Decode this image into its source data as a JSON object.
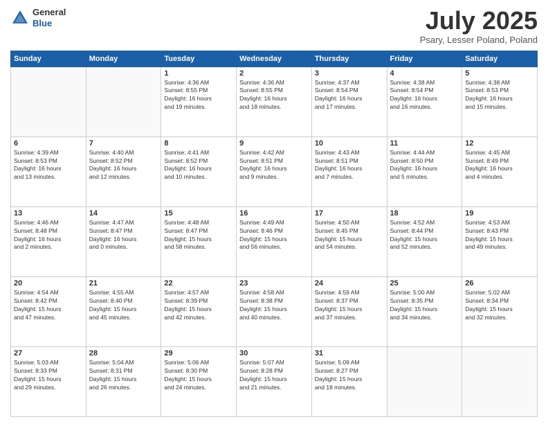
{
  "header": {
    "logo_general": "General",
    "logo_blue": "Blue",
    "title": "July 2025",
    "subtitle": "Psary, Lesser Poland, Poland"
  },
  "days_of_week": [
    "Sunday",
    "Monday",
    "Tuesday",
    "Wednesday",
    "Thursday",
    "Friday",
    "Saturday"
  ],
  "weeks": [
    [
      {
        "day": "",
        "info": ""
      },
      {
        "day": "",
        "info": ""
      },
      {
        "day": "1",
        "info": "Sunrise: 4:36 AM\nSunset: 8:55 PM\nDaylight: 16 hours\nand 19 minutes."
      },
      {
        "day": "2",
        "info": "Sunrise: 4:36 AM\nSunset: 8:55 PM\nDaylight: 16 hours\nand 18 minutes."
      },
      {
        "day": "3",
        "info": "Sunrise: 4:37 AM\nSunset: 8:54 PM\nDaylight: 16 hours\nand 17 minutes."
      },
      {
        "day": "4",
        "info": "Sunrise: 4:38 AM\nSunset: 8:54 PM\nDaylight: 16 hours\nand 16 minutes."
      },
      {
        "day": "5",
        "info": "Sunrise: 4:38 AM\nSunset: 8:53 PM\nDaylight: 16 hours\nand 15 minutes."
      }
    ],
    [
      {
        "day": "6",
        "info": "Sunrise: 4:39 AM\nSunset: 8:53 PM\nDaylight: 16 hours\nand 13 minutes."
      },
      {
        "day": "7",
        "info": "Sunrise: 4:40 AM\nSunset: 8:52 PM\nDaylight: 16 hours\nand 12 minutes."
      },
      {
        "day": "8",
        "info": "Sunrise: 4:41 AM\nSunset: 8:52 PM\nDaylight: 16 hours\nand 10 minutes."
      },
      {
        "day": "9",
        "info": "Sunrise: 4:42 AM\nSunset: 8:51 PM\nDaylight: 16 hours\nand 9 minutes."
      },
      {
        "day": "10",
        "info": "Sunrise: 4:43 AM\nSunset: 8:51 PM\nDaylight: 16 hours\nand 7 minutes."
      },
      {
        "day": "11",
        "info": "Sunrise: 4:44 AM\nSunset: 8:50 PM\nDaylight: 16 hours\nand 5 minutes."
      },
      {
        "day": "12",
        "info": "Sunrise: 4:45 AM\nSunset: 8:49 PM\nDaylight: 16 hours\nand 4 minutes."
      }
    ],
    [
      {
        "day": "13",
        "info": "Sunrise: 4:46 AM\nSunset: 8:48 PM\nDaylight: 16 hours\nand 2 minutes."
      },
      {
        "day": "14",
        "info": "Sunrise: 4:47 AM\nSunset: 8:47 PM\nDaylight: 16 hours\nand 0 minutes."
      },
      {
        "day": "15",
        "info": "Sunrise: 4:48 AM\nSunset: 8:47 PM\nDaylight: 15 hours\nand 58 minutes."
      },
      {
        "day": "16",
        "info": "Sunrise: 4:49 AM\nSunset: 8:46 PM\nDaylight: 15 hours\nand 56 minutes."
      },
      {
        "day": "17",
        "info": "Sunrise: 4:50 AM\nSunset: 8:45 PM\nDaylight: 15 hours\nand 54 minutes."
      },
      {
        "day": "18",
        "info": "Sunrise: 4:52 AM\nSunset: 8:44 PM\nDaylight: 15 hours\nand 52 minutes."
      },
      {
        "day": "19",
        "info": "Sunrise: 4:53 AM\nSunset: 8:43 PM\nDaylight: 15 hours\nand 49 minutes."
      }
    ],
    [
      {
        "day": "20",
        "info": "Sunrise: 4:54 AM\nSunset: 8:42 PM\nDaylight: 15 hours\nand 47 minutes."
      },
      {
        "day": "21",
        "info": "Sunrise: 4:55 AM\nSunset: 8:40 PM\nDaylight: 15 hours\nand 45 minutes."
      },
      {
        "day": "22",
        "info": "Sunrise: 4:57 AM\nSunset: 8:39 PM\nDaylight: 15 hours\nand 42 minutes."
      },
      {
        "day": "23",
        "info": "Sunrise: 4:58 AM\nSunset: 8:38 PM\nDaylight: 15 hours\nand 40 minutes."
      },
      {
        "day": "24",
        "info": "Sunrise: 4:59 AM\nSunset: 8:37 PM\nDaylight: 15 hours\nand 37 minutes."
      },
      {
        "day": "25",
        "info": "Sunrise: 5:00 AM\nSunset: 8:35 PM\nDaylight: 15 hours\nand 34 minutes."
      },
      {
        "day": "26",
        "info": "Sunrise: 5:02 AM\nSunset: 8:34 PM\nDaylight: 15 hours\nand 32 minutes."
      }
    ],
    [
      {
        "day": "27",
        "info": "Sunrise: 5:03 AM\nSunset: 8:33 PM\nDaylight: 15 hours\nand 29 minutes."
      },
      {
        "day": "28",
        "info": "Sunrise: 5:04 AM\nSunset: 8:31 PM\nDaylight: 15 hours\nand 26 minutes."
      },
      {
        "day": "29",
        "info": "Sunrise: 5:06 AM\nSunset: 8:30 PM\nDaylight: 15 hours\nand 24 minutes."
      },
      {
        "day": "30",
        "info": "Sunrise: 5:07 AM\nSunset: 8:28 PM\nDaylight: 15 hours\nand 21 minutes."
      },
      {
        "day": "31",
        "info": "Sunrise: 5:09 AM\nSunset: 8:27 PM\nDaylight: 15 hours\nand 18 minutes."
      },
      {
        "day": "",
        "info": ""
      },
      {
        "day": "",
        "info": ""
      }
    ]
  ]
}
